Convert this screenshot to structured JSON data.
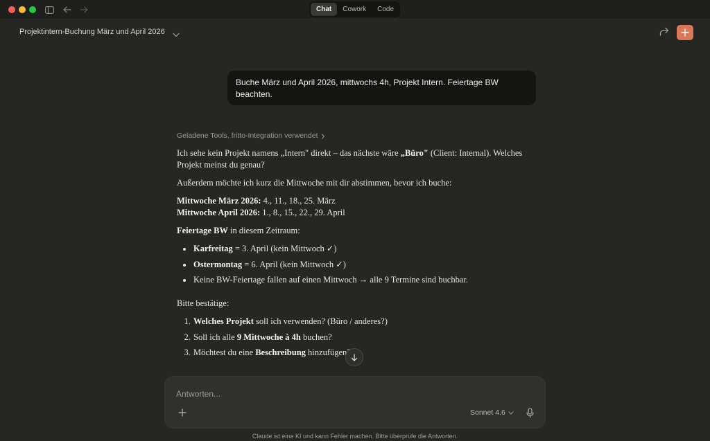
{
  "titlebar": {
    "modes": [
      {
        "label": "Chat",
        "active": true
      },
      {
        "label": "Cowork",
        "active": false
      },
      {
        "label": "Code",
        "active": false
      }
    ]
  },
  "header": {
    "title": "Projektintern-Buchung März und April 2026"
  },
  "user_message": "Buche März und April 2026, mittwochs 4h, Projekt Intern. Feiertage BW beachten.",
  "assistant": {
    "tools_line": "Geladene Tools, fritto-Integration verwendet",
    "p1_a": "Ich sehe kein Projekt namens „Intern\" direkt – das nächste wäre ",
    "p1_b": "„Büro\"",
    "p1_c": " (Client: Internal). Welches Projekt meinst du genau?",
    "p2": "Außerdem möchte ich kurz die Mittwoche mit dir abstimmen, bevor ich buche:",
    "march_label": "Mittwoche März 2026:",
    "march_dates": " 4., 11., 18., 25. März",
    "april_label": "Mittwoche April 2026:",
    "april_dates": " 1., 8., 15., 22., 29. April",
    "holidays_label": "Feiertage BW",
    "holidays_rest": " in diesem Zeitraum:",
    "holidays": [
      {
        "bold": "Karfreitag",
        "rest": " = 3. April (kein Mittwoch ✓)"
      },
      {
        "bold": "Ostermontag",
        "rest": " = 6. April (kein Mittwoch ✓)"
      },
      {
        "bold": "",
        "rest": "Keine BW-Feiertage fallen auf einen Mittwoch → alle 9 Termine sind buchbar."
      }
    ],
    "confirm": "Bitte bestätige:",
    "q1_bold": "Welches Projekt",
    "q1_rest": " soll ich verwenden? (Büro / anderes?)",
    "q2_a": "Soll ich alle ",
    "q2_bold": "9 Mittwoche à 4h",
    "q2_rest": " buchen?",
    "q3_a": "Möchtest du eine ",
    "q3_bold": "Beschreibung",
    "q3_rest": " hinzufügen?"
  },
  "composer": {
    "placeholder": "Antworten...",
    "model": "Sonnet 4.6"
  },
  "footer": {
    "disclaimer": "Claude ist eine KI und kann Fehler machen. Bitte überprüfe die Antworten."
  },
  "colors": {
    "background": "#262624",
    "accent": "#d97757",
    "bubble": "#141413"
  }
}
